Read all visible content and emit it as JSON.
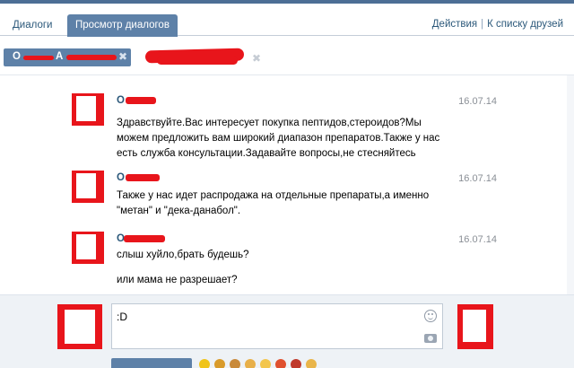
{
  "tabs": [
    {
      "label": "Диалоги"
    },
    {
      "label": "Просмотр диалогов"
    }
  ],
  "top_links": {
    "actions": "Действия",
    "friends": "К списку друзей"
  },
  "participants": {
    "chip_initial": "О",
    "chip_second_initial": "А"
  },
  "messages": [
    {
      "author": "О",
      "date": "16.07.14",
      "lines": [
        "Здравствуйте.Вас интересует покупка пептидов,стероидов?Мы",
        "можем предложить вам широкий диапазон препаратов.Также у нас",
        "есть служба консультации.Задавайте вопросы,не стесняйтесь"
      ]
    },
    {
      "author": "О",
      "date": "16.07.14",
      "lines": [
        "Также у нас идет распродажа на отдельные препараты,а именно",
        "\"метан\" и \"дека-данабол\"."
      ]
    },
    {
      "author": "О",
      "date": "16.07.14",
      "lines": [
        "слыш хуйло,брать будешь?",
        "",
        "или мама не разрешает?"
      ]
    }
  ],
  "composer": {
    "value": ":D"
  },
  "colors": {
    "accent": "#5e81a8",
    "link": "#2b587a",
    "redaction": "#e8151b"
  }
}
